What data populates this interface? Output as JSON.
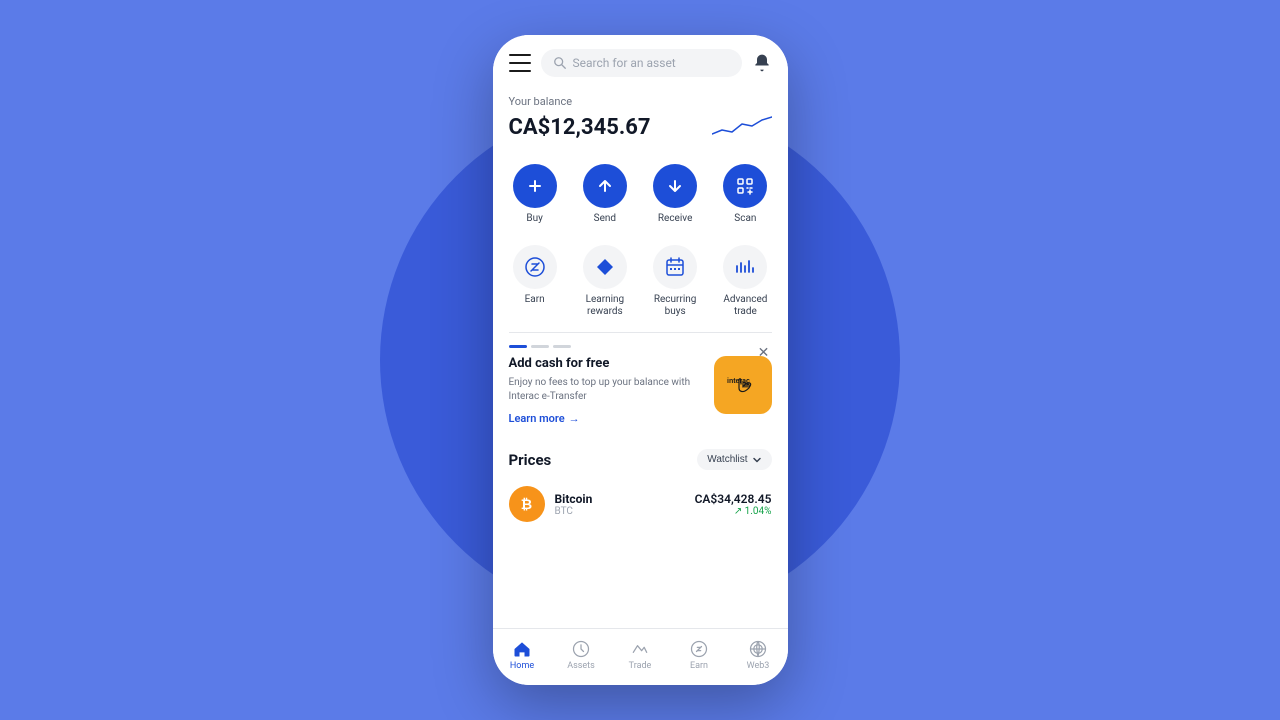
{
  "background": {
    "color": "#5b7be8",
    "circle_color": "#3a5bd9"
  },
  "header": {
    "search_placeholder": "Search for an asset"
  },
  "balance": {
    "label": "Your balance",
    "amount": "CA$12,345.67"
  },
  "actions": {
    "row1": [
      {
        "id": "buy",
        "label": "Buy",
        "icon": "plus"
      },
      {
        "id": "send",
        "label": "Send",
        "icon": "arrow-up"
      },
      {
        "id": "receive",
        "label": "Receive",
        "icon": "arrow-down"
      },
      {
        "id": "scan",
        "label": "Scan",
        "icon": "scan"
      }
    ],
    "row2": [
      {
        "id": "earn",
        "label": "Earn",
        "icon": "percent"
      },
      {
        "id": "learning",
        "label": "Learning rewards",
        "icon": "diamond"
      },
      {
        "id": "recurring",
        "label": "Recurring buys",
        "icon": "calendar"
      },
      {
        "id": "advanced",
        "label": "Advanced trade",
        "icon": "chart"
      }
    ]
  },
  "promo": {
    "title": "Add cash for free",
    "description": "Enjoy no fees to top up your balance with Interac e-Transfer",
    "link_label": "Learn more",
    "interac_text": "Interac"
  },
  "prices": {
    "title": "Prices",
    "watchlist_label": "Watchlist",
    "coins": [
      {
        "name": "Bitcoin",
        "ticker": "BTC",
        "price": "CA$34,428.45",
        "change": "↗ 1.04%",
        "color": "#f7931a",
        "symbol": "₿"
      }
    ]
  },
  "nav": {
    "items": [
      {
        "id": "home",
        "label": "Home",
        "active": true
      },
      {
        "id": "assets",
        "label": "Assets",
        "active": false
      },
      {
        "id": "trade",
        "label": "Trade",
        "active": false
      },
      {
        "id": "earn",
        "label": "Earn",
        "active": false
      },
      {
        "id": "web3",
        "label": "Web3",
        "active": false
      }
    ]
  }
}
